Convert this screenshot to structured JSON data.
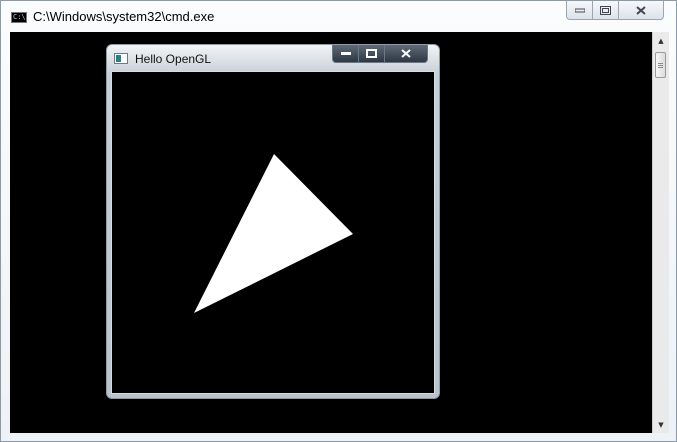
{
  "console_window": {
    "title": "C:\\Windows\\system32\\cmd.exe",
    "icon": "console-app-icon",
    "icon_text": "C:\\",
    "buttons": [
      "minimize",
      "maximize",
      "close"
    ],
    "background": "#000000"
  },
  "gl_window": {
    "title": "Hello OpenGL",
    "icon": "app-window-icon",
    "buttons": [
      "minimize",
      "maximize",
      "close"
    ],
    "clear_color": "#000000",
    "triangle_color": "#ffffff"
  }
}
